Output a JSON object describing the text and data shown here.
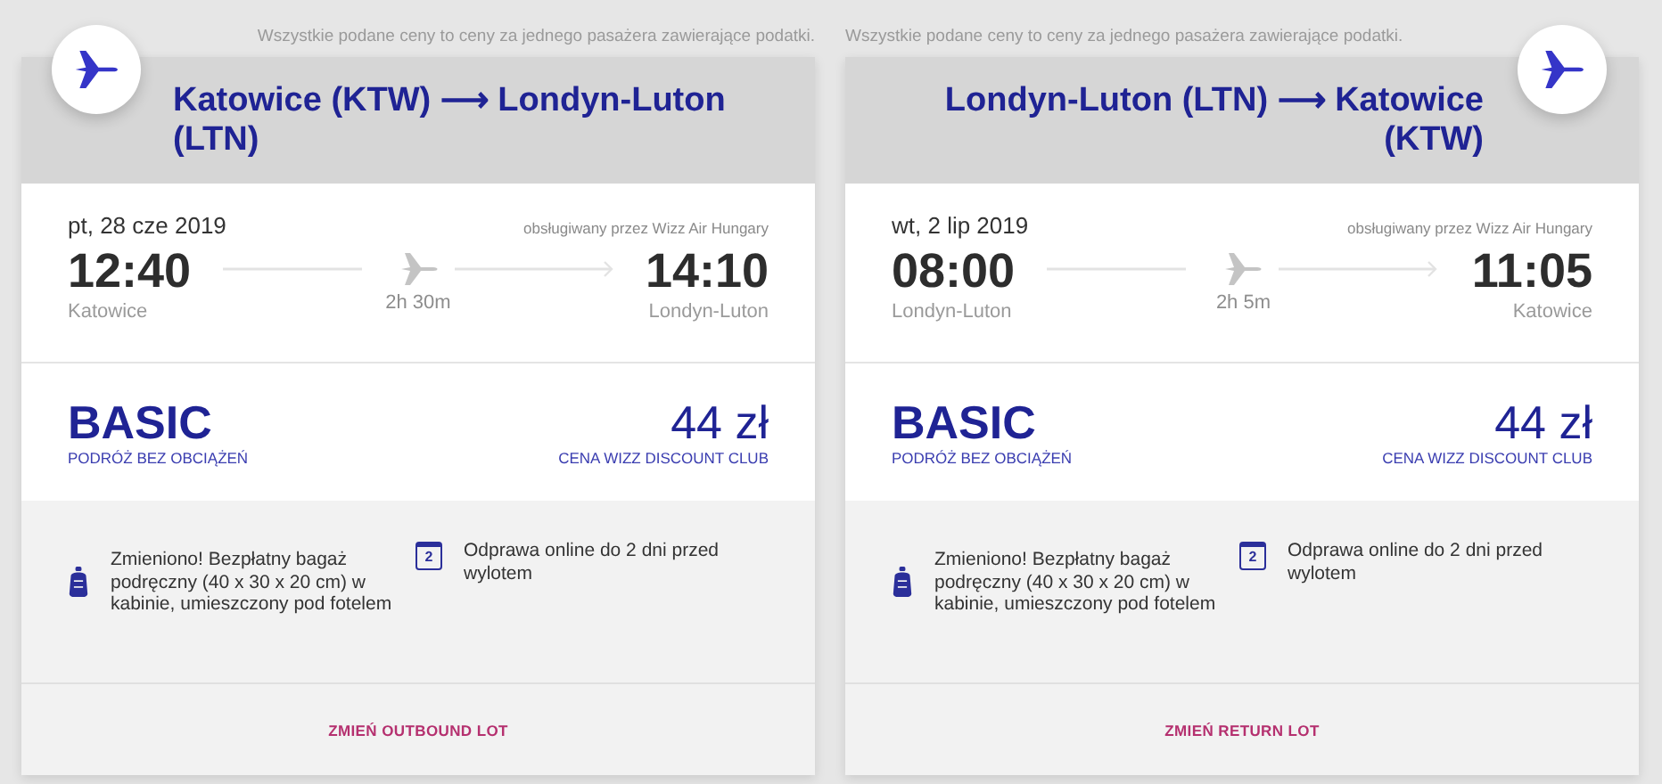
{
  "cards": [
    {
      "kind": "outbound",
      "notice": "Wszystkie podane ceny to ceny za jednego pasażera zawierające podatki.",
      "title": "Katowice (KTW) ⟶ Londyn-Luton (LTN)",
      "date": "pt, 28 cze 2019",
      "operator": "obsługiwany przez Wizz Air Hungary",
      "depart_time": "12:40",
      "depart_city": "Katowice",
      "duration": "2h 30m",
      "arrive_time": "14:10",
      "arrive_city": "Londyn-Luton",
      "fare": "BASIC",
      "fare_note": "PODRÓŻ BEZ OBCIĄŻEŃ",
      "price": "44 zł",
      "price_note": "CENA WIZZ DISCOUNT CLUB",
      "features": [
        {
          "kind": "bag",
          "text": "Zmieniono! Bezpłatny bagaż podręczny (40 x 30 x 20 cm) w kabinie, umieszczony pod fotelem"
        },
        {
          "kind": "calendar",
          "icon_text": "2",
          "text": "Odprawa online do 2 dni przed wylotem"
        }
      ],
      "button": "ZMIEŃ OUTBOUND LOT"
    },
    {
      "kind": "return",
      "notice": "Wszystkie podane ceny to ceny za jednego pasażera zawierające podatki.",
      "title": "Londyn-Luton (LTN) ⟶ Katowice (KTW)",
      "date": "wt, 2 lip 2019",
      "operator": "obsługiwany przez Wizz Air Hungary",
      "depart_time": "08:00",
      "depart_city": "Londyn-Luton",
      "duration": "2h 5m",
      "arrive_time": "11:05",
      "arrive_city": "Katowice",
      "fare": "BASIC",
      "fare_note": "PODRÓŻ BEZ OBCIĄŻEŃ",
      "price": "44 zł",
      "price_note": "CENA WIZZ DISCOUNT CLUB",
      "features": [
        {
          "kind": "bag",
          "text": "Zmieniono! Bezpłatny bagaż podręczny (40 x 30 x 20 cm) w kabinie, umieszczony pod fotelem"
        },
        {
          "kind": "calendar",
          "icon_text": "2",
          "text": "Odprawa online do 2 dni przed wylotem"
        }
      ],
      "button": "ZMIEŃ RETURN LOT"
    }
  ]
}
